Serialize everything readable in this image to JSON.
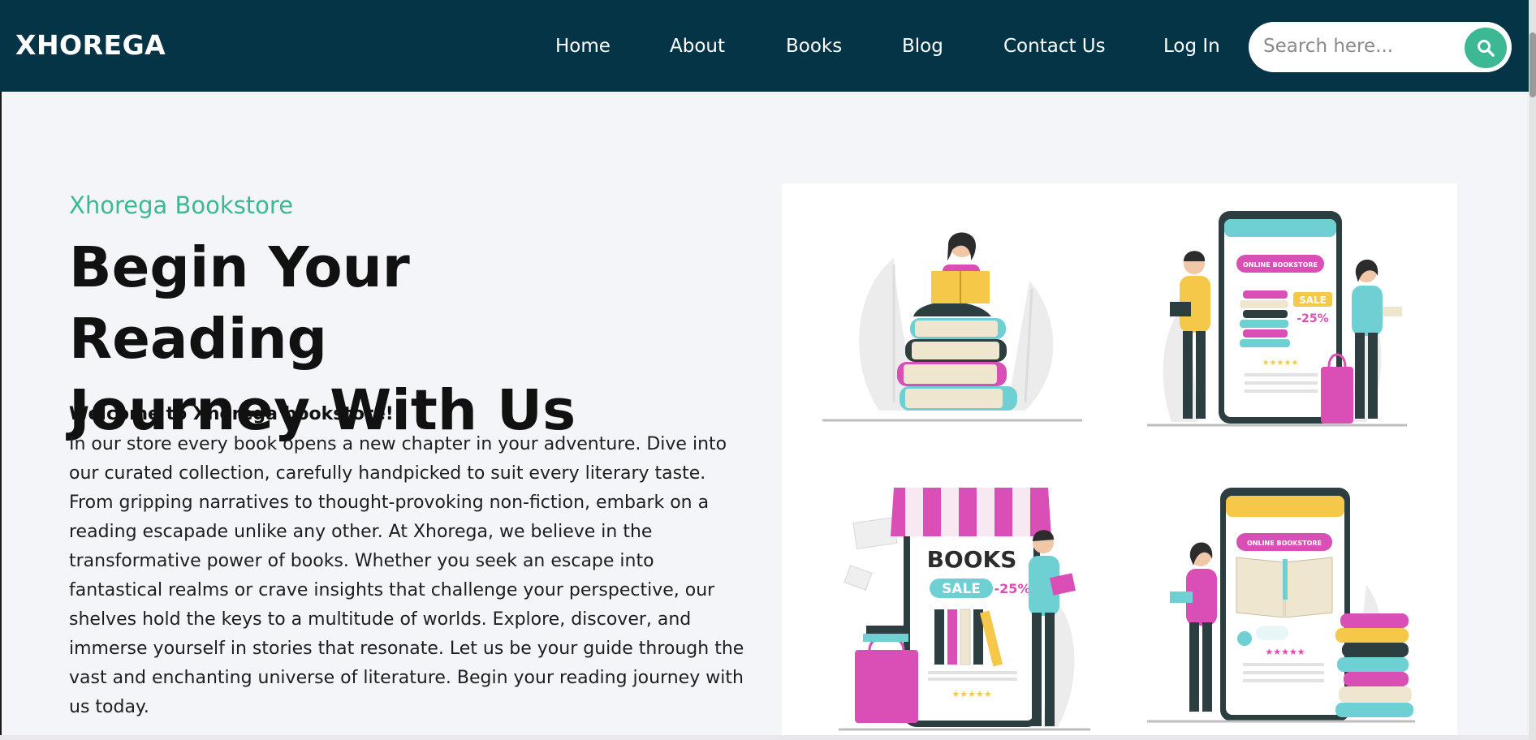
{
  "brand": "XHOREGA",
  "nav": {
    "items": [
      {
        "label": "Home"
      },
      {
        "label": "About"
      },
      {
        "label": "Books"
      },
      {
        "label": "Blog"
      },
      {
        "label": "Contact Us"
      },
      {
        "label": "Log In"
      }
    ]
  },
  "search": {
    "placeholder": "Search here...",
    "icon": "search-icon"
  },
  "hero": {
    "tagline": "Xhorega Bookstore",
    "headline_line1": "Begin Your Reading",
    "headline_line2": "Journey With Us",
    "welcome": "Welcome to Xhorega bookstore!",
    "body": "In our store every book opens a new chapter in your adventure. Dive into our curated collection, carefully handpicked to suit every literary taste. From gripping narratives to thought-provoking non-fiction, embark on a reading escapade unlike any other. At Xhorega, we believe in the transformative power of books. Whether you seek an escape into fantastical realms or crave insights that challenge your perspective, our shelves hold the keys to a multitude of worlds. Explore, discover, and immerse yourself in stories that resonate. Let us be your guide through the vast and enchanting universe of literature. Begin your reading journey with us today."
  },
  "illustrations": {
    "online_label_1": "ONLINE BOOKSTORE",
    "sale_label_1": "SALE",
    "discount_1": "-25%",
    "books_label": "BOOKS",
    "sale_label_2": "SALE",
    "discount_2": "-25%",
    "online_label_2": "ONLINE BOOKSTORE",
    "stars": "★★★★★"
  },
  "colors": {
    "navbar": "#063447",
    "accent": "#3db894",
    "pink": "#d94fb6",
    "teal": "#6fd0d4",
    "yellow": "#f5c84a",
    "dark": "#2c3e3f"
  }
}
